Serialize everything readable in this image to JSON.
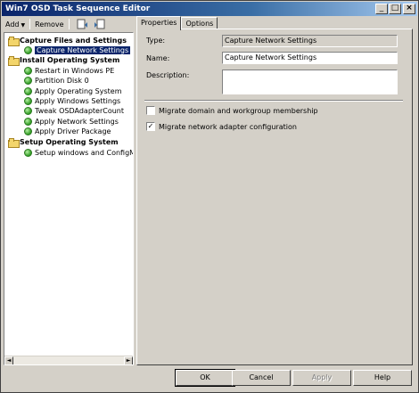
{
  "window": {
    "title": "Win7 OSD Task Sequence Editor",
    "controls": {
      "minimize": "_",
      "maximize": "□",
      "close": "×"
    }
  },
  "toolbar": {
    "add_label": "Add",
    "add_dropdown": "▼",
    "remove_label": "Remove"
  },
  "tree": {
    "items": [
      {
        "label": "Capture Files and Settings",
        "type": "group",
        "icon": "folder-icon"
      },
      {
        "label": "Capture Network Settings",
        "type": "step",
        "icon": "check-icon",
        "selected": true
      },
      {
        "label": "Install Operating System",
        "type": "group",
        "icon": "folder-icon"
      },
      {
        "label": "Restart in Windows PE",
        "type": "step",
        "icon": "check-icon"
      },
      {
        "label": "Partition Disk 0",
        "type": "step",
        "icon": "check-icon"
      },
      {
        "label": "Apply Operating System",
        "type": "step",
        "icon": "check-icon"
      },
      {
        "label": "Apply Windows Settings",
        "type": "step",
        "icon": "check-icon"
      },
      {
        "label": "Tweak OSDAdapterCount",
        "type": "step",
        "icon": "check-icon"
      },
      {
        "label": "Apply Network Settings",
        "type": "step",
        "icon": "check-icon"
      },
      {
        "label": "Apply Driver Package",
        "type": "step",
        "icon": "check-icon"
      },
      {
        "label": "Setup Operating System",
        "type": "group",
        "icon": "folder-icon"
      },
      {
        "label": "Setup windows and ConfigMgr",
        "type": "step",
        "icon": "check-icon"
      }
    ],
    "scroll_left": "◄",
    "scroll_right": "►"
  },
  "tabs": [
    {
      "label": "Properties",
      "active": true
    },
    {
      "label": "Options",
      "active": false
    }
  ],
  "properties": {
    "type_label": "Type:",
    "type_value": "Capture Network Settings",
    "name_label": "Name:",
    "name_value": "Capture Network Settings",
    "description_label": "Description:",
    "description_value": ""
  },
  "options": {
    "migrate_domain_label": "Migrate domain and workgroup membership",
    "migrate_domain_checked": false,
    "migrate_adapter_label": "Migrate network adapter configuration",
    "migrate_adapter_checked": true,
    "check_mark": "✓"
  },
  "buttons": {
    "ok": "OK",
    "cancel": "Cancel",
    "apply": "Apply",
    "help": "Help"
  }
}
